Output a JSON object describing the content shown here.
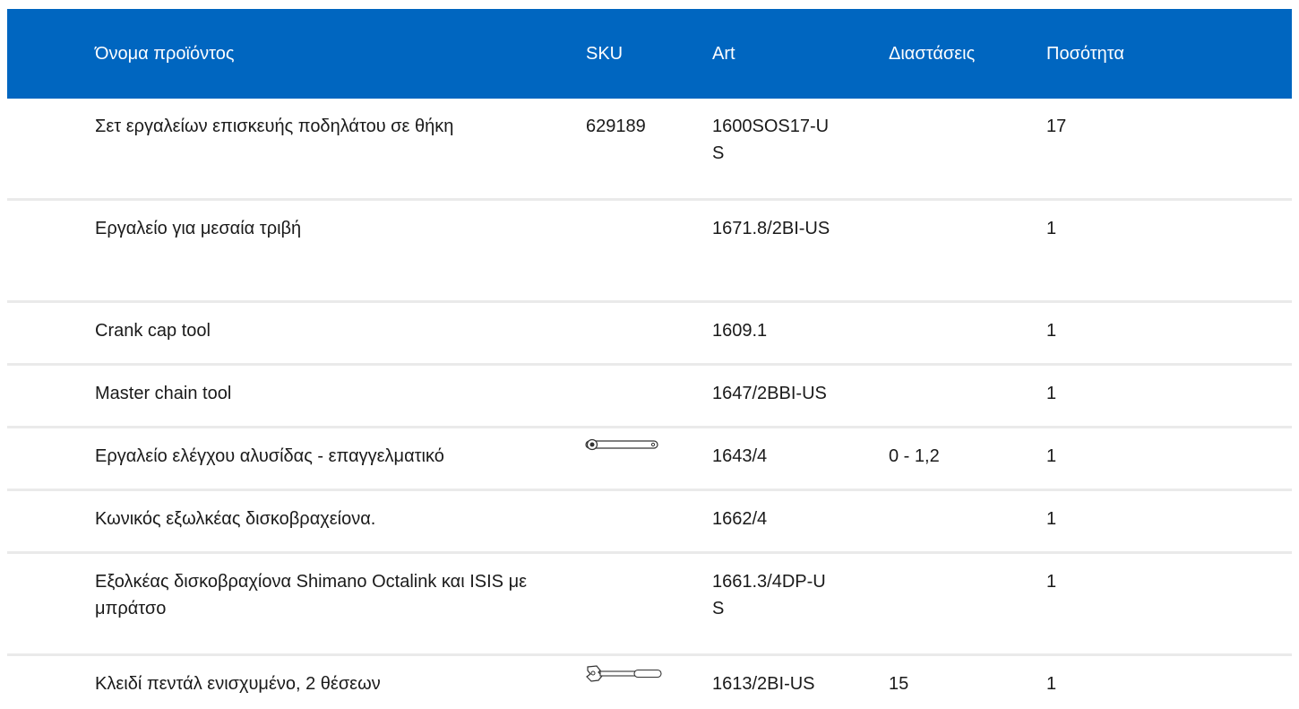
{
  "table": {
    "headers": {
      "name": "Όνομα προϊόντος",
      "sku": "SKU",
      "art": "Art",
      "dimensions": "Διαστάσεις",
      "quantity": "Ποσότητα"
    },
    "rows": [
      {
        "name": "Σετ εργαλείων επισκευής ποδηλάτου σε θήκη",
        "sku": "629189",
        "art": "1600SOS17-US",
        "dimensions": "",
        "quantity": "17"
      },
      {
        "name": "Εργαλείο για μεσαία τριβή",
        "sku": "",
        "art": "1671.8/2BI-US",
        "dimensions": "",
        "quantity": "1"
      },
      {
        "name": "Crank cap tool",
        "sku": "",
        "art": "1609.1",
        "dimensions": "",
        "quantity": "1"
      },
      {
        "name": "Master chain tool",
        "sku": "",
        "art": "1647/2BBI-US",
        "dimensions": "",
        "quantity": "1"
      },
      {
        "name": "Εργαλείο ελέγχου αλυσίδας - επαγγελματικό",
        "sku_icon": "chain-checker-tool-icon",
        "art": "1643/4",
        "dimensions": "0 - 1,2",
        "quantity": "1"
      },
      {
        "name": "Κωνικός εξωλκέας δισκοβραχείονα.",
        "sku": "",
        "art": "1662/4",
        "dimensions": "",
        "quantity": "1"
      },
      {
        "name": "Εξολκέας δισκοβραχίονα Shimano Octalink και ISIS με μπράτσο",
        "sku": "",
        "art": "1661.3/4DP-US",
        "dimensions": "",
        "quantity": "1"
      },
      {
        "name": "Κλειδί πεντάλ ενισχυμένο, 2 θέσεων",
        "sku_icon": "pedal-wrench-icon",
        "art": "1613/2BI-US",
        "dimensions": "15",
        "quantity": "1"
      }
    ]
  },
  "colors": {
    "header_bg": "#0066c0",
    "header_text": "#ffffff",
    "row_divider": "#eaeaea"
  }
}
